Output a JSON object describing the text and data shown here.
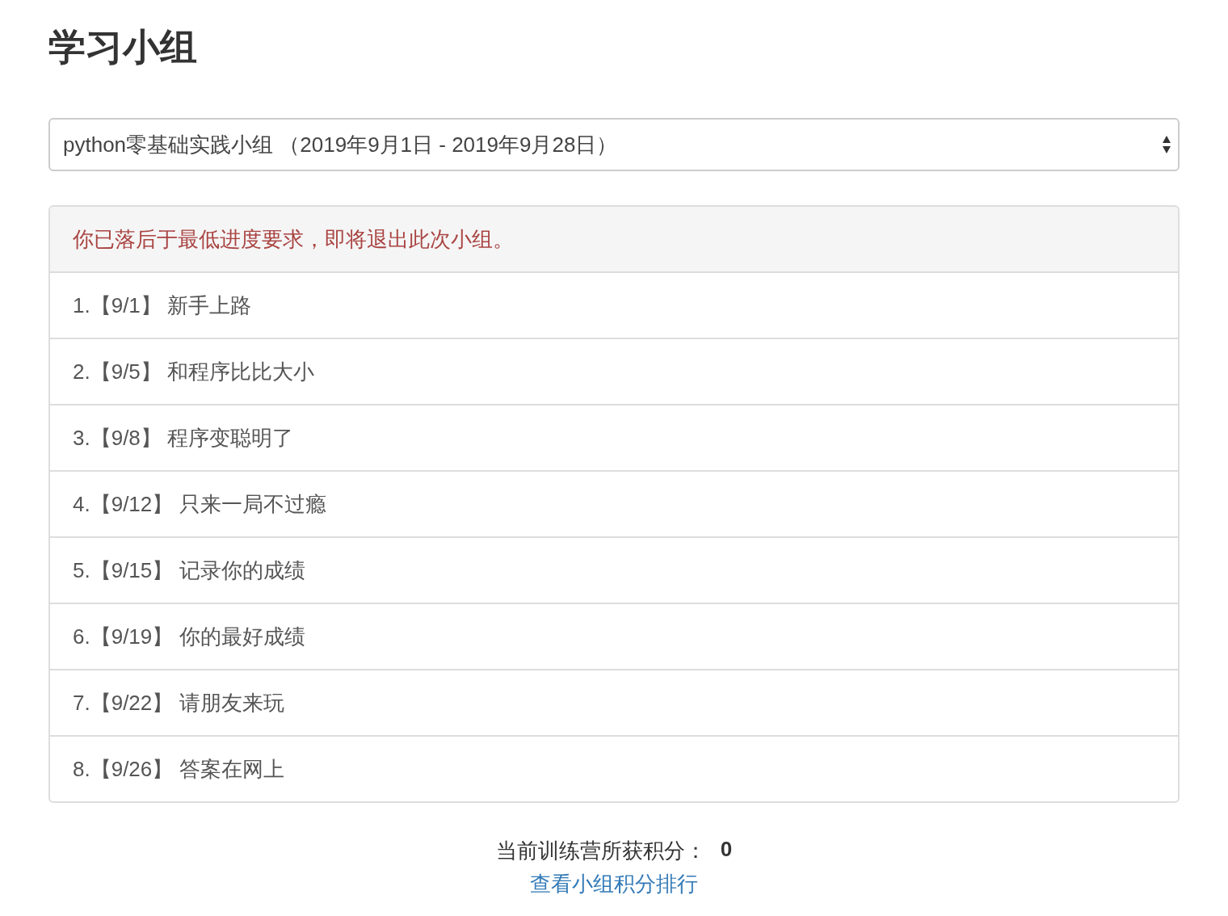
{
  "page_title": "学习小组",
  "group_select": {
    "value": "python零基础实践小组 （2019年9月1日 - 2019年9月28日）"
  },
  "lessons_panel": {
    "warning": "你已落后于最低进度要求，即将退出此次小组。",
    "items": [
      {
        "text": "1.【9/1】 新手上路"
      },
      {
        "text": "2.【9/5】 和程序比比大小"
      },
      {
        "text": "3.【9/8】 程序变聪明了"
      },
      {
        "text": "4.【9/12】 只来一局不过瘾"
      },
      {
        "text": "5.【9/15】 记录你的成绩"
      },
      {
        "text": "6.【9/19】 你的最好成绩"
      },
      {
        "text": "7.【9/22】 请朋友来玩"
      },
      {
        "text": "8.【9/26】 答案在网上"
      }
    ]
  },
  "score": {
    "label": "当前训练营所获积分：",
    "value": "0"
  },
  "ranking_link": "查看小组积分排行"
}
